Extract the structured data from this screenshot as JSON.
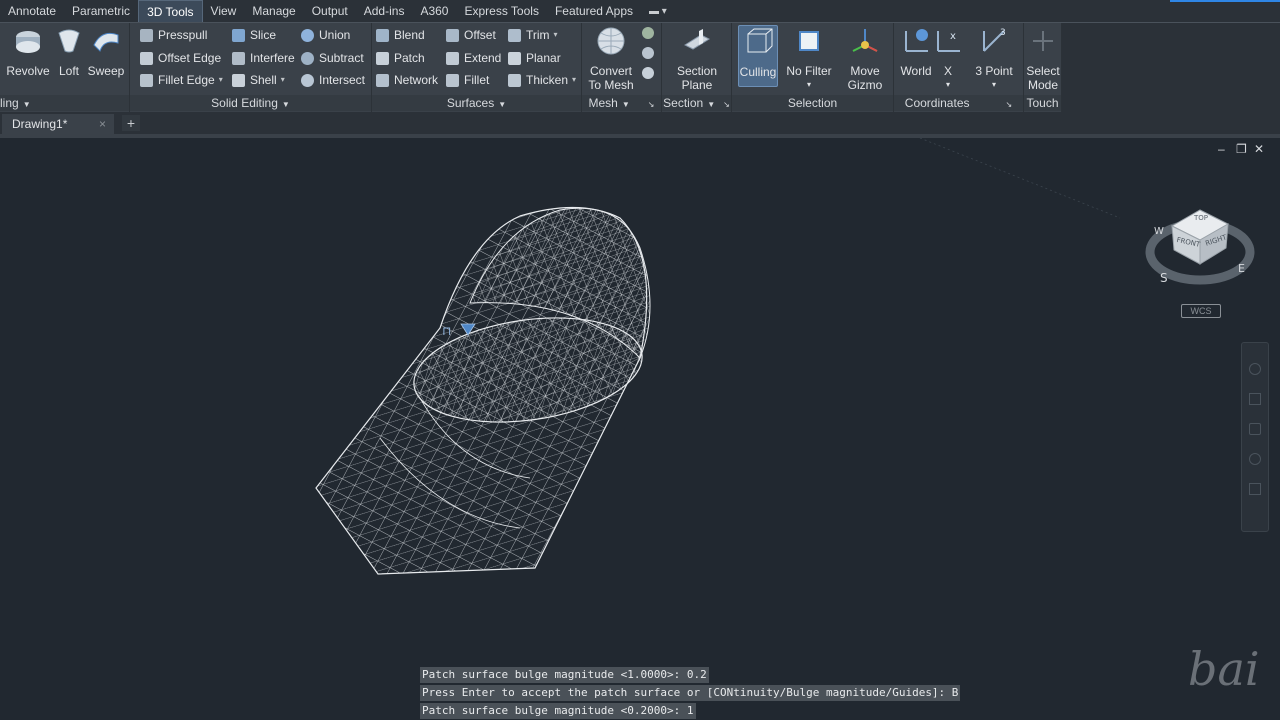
{
  "tabs": [
    "Annotate",
    "Parametric",
    "3D Tools",
    "View",
    "Manage",
    "Output",
    "Add-ins",
    "A360",
    "Express Tools",
    "Featured Apps"
  ],
  "active_tab": "3D Tools",
  "ribbon": {
    "modeling": {
      "title": "ling",
      "revolve": "Revolve",
      "loft": "Loft",
      "sweep": "Sweep"
    },
    "solid_editing": {
      "title": "Solid Editing",
      "presspull": "Presspull",
      "offset_edge": "Offset Edge",
      "fillet_edge": "Fillet Edge",
      "slice": "Slice",
      "interfere": "Interfere",
      "shell": "Shell",
      "union": "Union",
      "subtract": "Subtract",
      "intersect": "Intersect"
    },
    "surfaces": {
      "title": "Surfaces",
      "blend": "Blend",
      "patch": "Patch",
      "network": "Network",
      "offset": "Offset",
      "extend": "Extend",
      "fillet": "Fillet",
      "trim": "Trim",
      "planar": "Planar",
      "thicken": "Thicken"
    },
    "mesh": {
      "title": "Mesh",
      "convert_line1": "Convert",
      "convert_line2": "To Mesh"
    },
    "section": {
      "title": "Section",
      "plane_line1": "Section",
      "plane_line2": "Plane"
    },
    "selection": {
      "title": "Selection",
      "culling": "Culling",
      "no_filter": "No Filter",
      "move_gizmo_line1": "Move",
      "move_gizmo_line2": "Gizmo"
    },
    "coordinates": {
      "title": "Coordinates",
      "world": "World",
      "x": "X",
      "three_point": "3 Point"
    },
    "touch": {
      "title": "Touch",
      "select_mode_line1": "Select",
      "select_mode_line2": "Mode"
    }
  },
  "file_tab": {
    "name": "Drawing1*",
    "close": "×",
    "new": "+"
  },
  "viewcube": {
    "top": "TOP",
    "front": "FRONT",
    "right": "RIGHT",
    "w": "W",
    "s": "S",
    "e": "E",
    "wcs": "WCS"
  },
  "window_controls": {
    "minimize": "–",
    "restore": "❐",
    "close": "✕"
  },
  "command_lines": [
    "Patch surface bulge magnitude <1.0000>: 0.2",
    "Press Enter to accept the patch surface or [CONtinuity/Bulge magnitude/Guides]: B",
    "Patch surface bulge magnitude <0.2000>: 1"
  ],
  "watermark": "bai"
}
